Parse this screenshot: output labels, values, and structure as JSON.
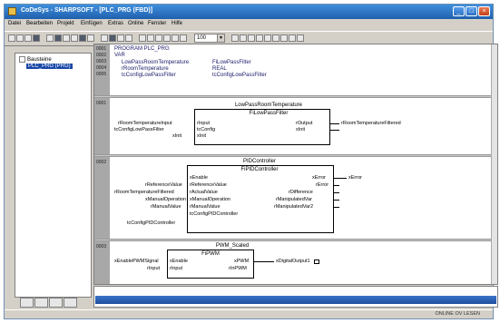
{
  "window": {
    "title": "CoDeSys - SHARPSOFT - [PLC_PRG (FBD)]",
    "minimize": "_",
    "maximize": "□",
    "close": "×"
  },
  "menu": [
    "Datei",
    "Bearbeiten",
    "Projekt",
    "Einfügen",
    "Extras",
    "Online",
    "Fenster",
    "Hilfe"
  ],
  "toolbar": {
    "zoom_value": "100"
  },
  "tree": {
    "root": "Bausteine",
    "selected": "PLC_PRG (PRG)"
  },
  "declarations": {
    "header": [
      "PROGRAM PLC_PRG",
      "VAR"
    ],
    "rows": [
      {
        "name": "LowPassRoomTemperature",
        "type": "FiLowPassFilter"
      },
      {
        "name": "rRoomTemperature",
        "type": "REAL"
      },
      {
        "name": "tcConfigLowPassFilter",
        "type": "tcConfigLowPassFilter"
      }
    ]
  },
  "networks": [
    {
      "number": "0001",
      "instance": "LowPassRoomTemperature",
      "type": "FiLowPassFilter",
      "in_pins": [
        "rInput",
        "tcConfig",
        "xInit"
      ],
      "out_pins": [
        "rOutput",
        "xInit"
      ],
      "in_nets": [
        "rRoomTemperatureInput",
        "tcConfigLowPassFilter",
        "xInit"
      ],
      "out_nets": [
        "rRoomTemperatureFiltered"
      ]
    },
    {
      "number": "0002",
      "instance": "PIDController",
      "type": "FiPIDController",
      "in_pins": [
        "xEnable",
        "rReferenceValue",
        "rActualValue",
        "xManualOperation",
        "rManualValue",
        "tcConfigPIDController"
      ],
      "out_pins": [
        "xError",
        "rError",
        "rDifference",
        "rManipulatedVar",
        "rManipulatedVar2"
      ],
      "in_nets": [
        "rReferenceValue",
        "rRoomTemperatureFiltered",
        "xManualOperation",
        "rManualValue",
        "tcConfigPIDController"
      ],
      "out_nets": [
        "xError"
      ]
    },
    {
      "number": "0003",
      "instance": "PWM_Scaled",
      "type": "FiPWM",
      "in_pins": [
        "xEnable",
        "rInput"
      ],
      "out_pins": [
        "xPWM",
        "rInPWM"
      ],
      "in_nets": [
        "xEnablePWMSignal",
        "rInput"
      ],
      "out_nets": [
        "xDigitalOutput1"
      ]
    }
  ],
  "status": {
    "text": "ONLINE  OV  LESEN"
  }
}
